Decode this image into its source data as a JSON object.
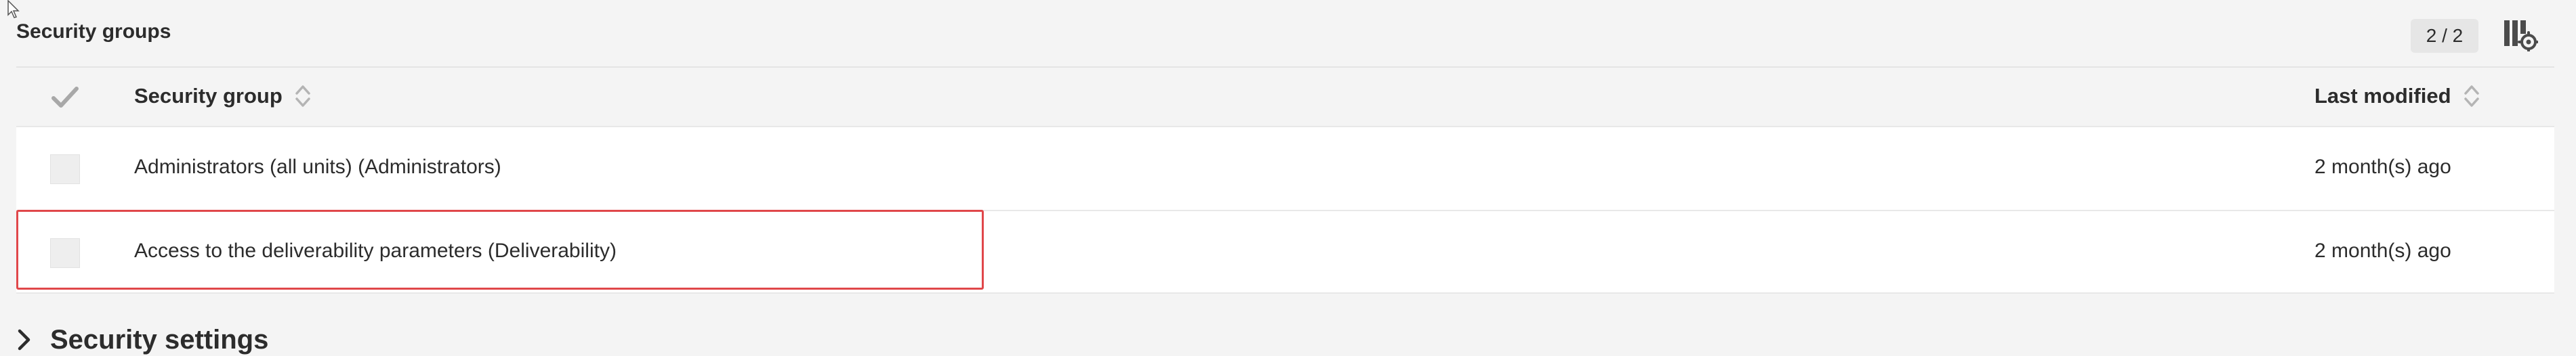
{
  "security_groups": {
    "title": "Security groups",
    "count": "2 / 2",
    "columns": [
      "Security group",
      "Last modified"
    ],
    "rows": [
      {
        "group": "Administrators (all units) (Administrators)",
        "last_modified": "2 month(s) ago"
      },
      {
        "group": "Access to the deliverability parameters (Deliverability)",
        "last_modified": "2 month(s) ago"
      }
    ]
  },
  "security_settings": {
    "label": "Security settings"
  },
  "icons": {
    "select_all": "checkmark-icon",
    "sort": "sort-icon",
    "configure_columns": "column-settings-icon",
    "expand": "chevron-right-icon",
    "cursor": "mouse-cursor-icon"
  },
  "colors": {
    "highlight": "#e0474a",
    "background": "#f4f4f4",
    "row_background": "#ffffff"
  }
}
